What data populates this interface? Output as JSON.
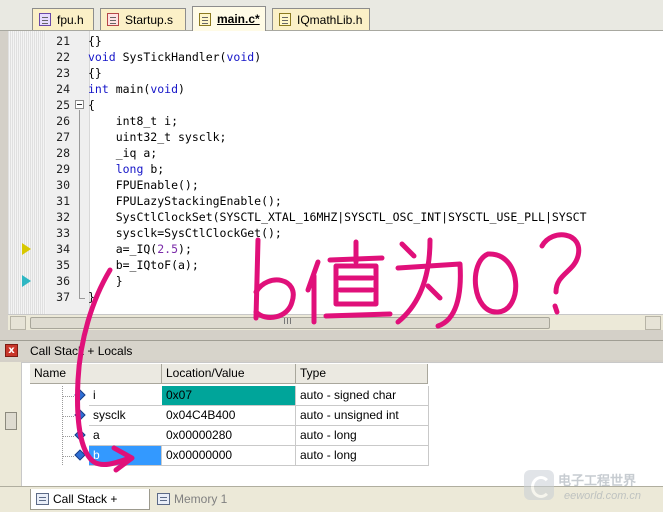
{
  "editor_tabs": [
    {
      "label": "fpu.h",
      "icon": "header-file-icon"
    },
    {
      "label": "Startup.s",
      "icon": "asm-file-icon"
    },
    {
      "label": "main.c*",
      "icon": "c-file-icon"
    },
    {
      "label": "IQmathLib.h",
      "icon": "header-file-icon"
    }
  ],
  "active_tab": "main.c*",
  "code_lines": [
    {
      "num": "21",
      "text": "{}"
    },
    {
      "num": "22",
      "text": "void SysTickHandler(void)"
    },
    {
      "num": "23",
      "text": "{}"
    },
    {
      "num": "24",
      "text": "int main(void)"
    },
    {
      "num": "25",
      "text": "{"
    },
    {
      "num": "26",
      "text": "    int8_t i;"
    },
    {
      "num": "27",
      "text": "    uint32_t sysclk;"
    },
    {
      "num": "28",
      "text": "    _iq a;"
    },
    {
      "num": "29",
      "text": "    long b;"
    },
    {
      "num": "30",
      "text": "    FPUEnable();"
    },
    {
      "num": "31",
      "text": "    FPULazyStackingEnable();"
    },
    {
      "num": "32",
      "text": "    SysCtlClockSet(SYSCTL_XTAL_16MHZ|SYSCTL_OSC_INT|SYSCTL_USE_PLL|SYSCT"
    },
    {
      "num": "33",
      "text": "    sysclk=SysCtlClockGet();"
    },
    {
      "num": "34",
      "text": "    a=_IQ(2.5);"
    },
    {
      "num": "35",
      "text": "    b=_IQtoF(a);"
    },
    {
      "num": "36",
      "text": "    }"
    },
    {
      "num": "37",
      "text": "}"
    }
  ],
  "hscroll_grip": "III",
  "panel": {
    "title": "Call Stack + Locals",
    "close_label": "x",
    "columns": [
      "Name",
      "Location/Value",
      "Type"
    ],
    "rows": [
      {
        "name": "i",
        "value": "0x07",
        "type": "auto - signed char"
      },
      {
        "name": "sysclk",
        "value": "0x04C4B400",
        "type": "auto - unsigned int"
      },
      {
        "name": "a",
        "value": "0x00000280",
        "type": "auto - long"
      },
      {
        "name": "b",
        "value": "0x00000000",
        "type": "auto - long"
      }
    ]
  },
  "bottom_tabs": [
    {
      "label": "Call Stack + Locals",
      "active": true
    },
    {
      "label": "Memory 1",
      "active": false
    }
  ],
  "annotation": "b值为0？",
  "watermark": {
    "cn": "电子工程世界",
    "en": "eeworld.com.cn"
  },
  "colors": {
    "keyword": "#1515c8",
    "number": "#7a2aa8",
    "selected_value": "#00a59a",
    "selected_name": "#3399ff",
    "annotation_red": "#e0107a"
  }
}
